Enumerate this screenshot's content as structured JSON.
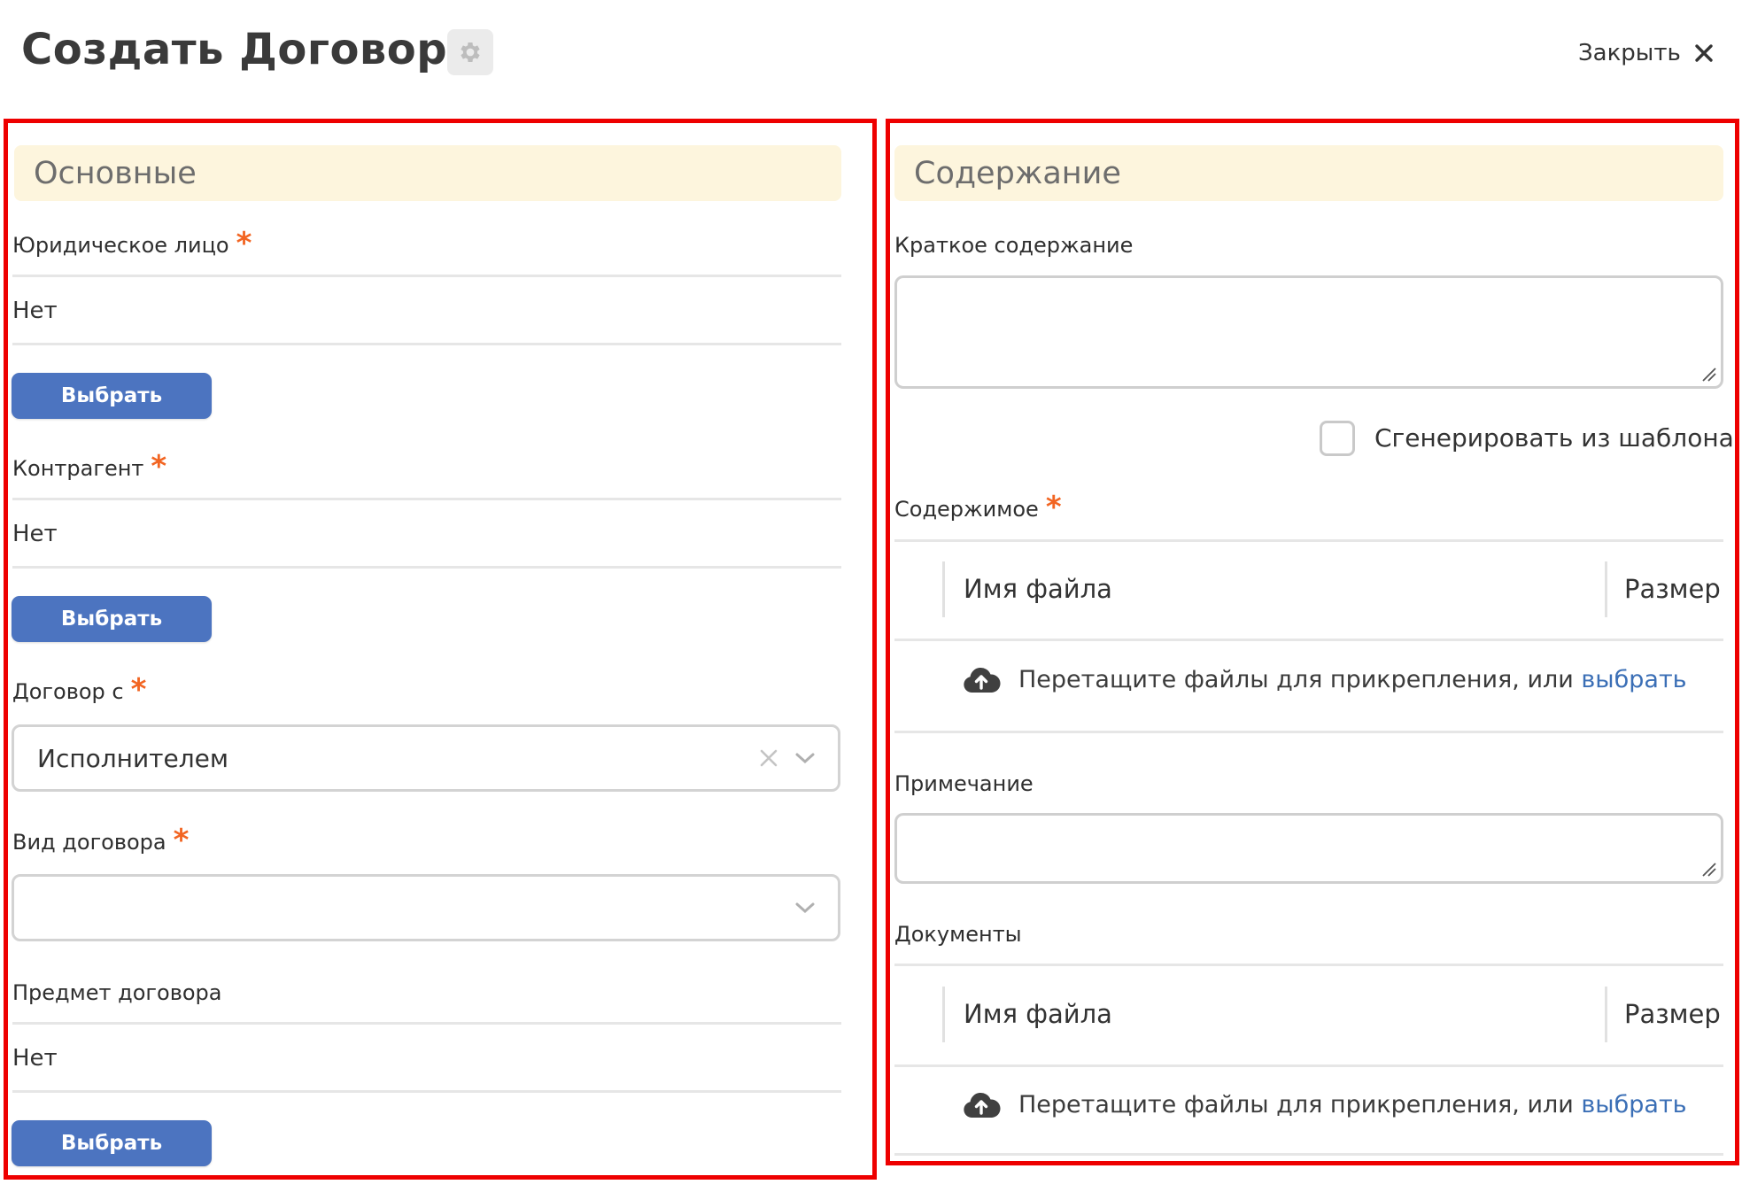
{
  "header": {
    "title": "Создать Договор",
    "settings_icon": "gear-icon",
    "close_label": "Закрыть",
    "close_icon": "close-icon"
  },
  "left": {
    "section_title": "Основные",
    "legal_entity": {
      "label": "Юридическое лицо",
      "required_mark": "*",
      "value": "Нет",
      "button": "Выбрать"
    },
    "counterparty": {
      "label": "Контрагент",
      "required_mark": "*",
      "value": "Нет",
      "button": "Выбрать"
    },
    "contract_with": {
      "label": "Договор с",
      "required_mark": "*",
      "selected": "Исполнителем"
    },
    "contract_type": {
      "label": "Вид договора",
      "required_mark": "*",
      "selected": ""
    },
    "subject": {
      "label": "Предмет договора",
      "value": "Нет",
      "button": "Выбрать"
    }
  },
  "right": {
    "section_title": "Содержание",
    "summary": {
      "label": "Краткое содержание",
      "value": ""
    },
    "generate_checkbox": {
      "label": "Сгенерировать из шаблона",
      "checked": false
    },
    "content": {
      "label": "Содержимое",
      "required_mark": "*",
      "columns": [
        "Имя файла",
        "Размер"
      ],
      "drop_text": "Перетащите файлы для прикрепления, или ",
      "drop_link": "выбрать",
      "upload_icon": "cloud-upload-icon"
    },
    "note": {
      "label": "Примечание",
      "value": ""
    },
    "documents": {
      "label": "Документы",
      "columns": [
        "Имя файла",
        "Размер"
      ],
      "drop_text": "Перетащите файлы для прикрепления, или ",
      "drop_link": "выбрать",
      "upload_icon": "cloud-upload-icon"
    }
  },
  "colors": {
    "primary_button": "#4c74c0",
    "section_header_bg": "#fdf5dd",
    "required_star": "#f26522",
    "highlight_border": "#ee0000",
    "link": "#3b6fb6"
  }
}
